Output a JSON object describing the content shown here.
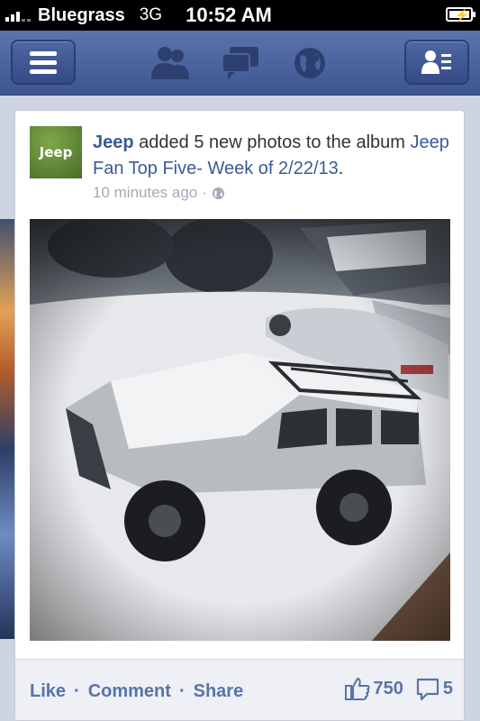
{
  "status_bar": {
    "carrier": "Bluegrass",
    "network": "3G",
    "time": "10:52 AM"
  },
  "navbar": {
    "icons": [
      "menu-icon",
      "friends-icon",
      "messages-icon",
      "globe-icon",
      "contacts-icon"
    ]
  },
  "post": {
    "avatar_text": "Jeep",
    "actor": "Jeep",
    "action": " added 5 new photos to the album ",
    "album": "Jeep Fan Top Five- Week of 2/22/13",
    "album_suffix": ".",
    "time": "10 minutes ago",
    "separator": "·",
    "privacy_icon": "globe-icon"
  },
  "footer": {
    "like": "Like",
    "comment": "Comment",
    "share": "Share",
    "dot": "·",
    "likes_count": "750",
    "comments_count": "5"
  },
  "colors": {
    "nav_blue": "#4a63a0",
    "link_blue": "#3b5998",
    "footer_text": "#5874a6"
  }
}
